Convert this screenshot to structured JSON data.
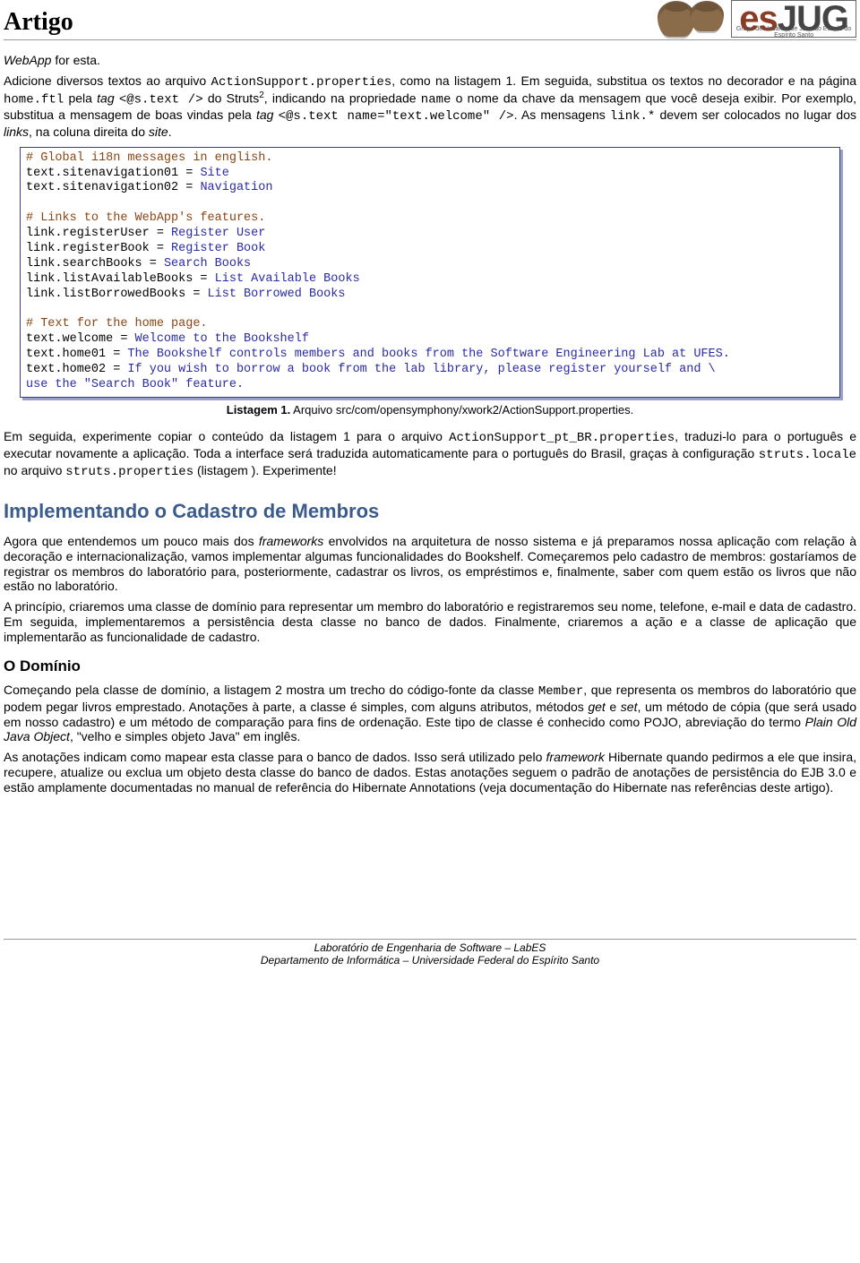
{
  "header": {
    "title": "Artigo",
    "logo_text": "esJUG",
    "logo_subtitle": "Grupo de Usuários de Java do Estado do Espírito Santo"
  },
  "intro": {
    "p1_part1": "WebApp",
    "p1_part2": " for esta.",
    "p2_part1": "Adicione diversos textos ao arquivo ",
    "p2_code1": "ActionSupport.properties",
    "p2_part2": ", como na listagem 1. Em seguida, substitua os textos no decorador e na página ",
    "p2_code2": "home.ftl",
    "p2_part3": " pela ",
    "p2_ital1": "tag",
    "p2_part4": " ",
    "p2_code3": "<@s.text />",
    "p2_part5": " do Struts",
    "p2_sup": "2",
    "p2_part6": ", indicando na propriedade ",
    "p2_code4": "name",
    "p2_part7": " o nome da chave da mensagem que você deseja exibir. Por exemplo, substitua a mensagem de boas vindas pela ",
    "p2_ital2": "tag",
    "p2_part8": " ",
    "p2_code5": "<@s.text name=\"text.welcome\" />",
    "p2_part9": ". As mensagens ",
    "p2_code6": "link.*",
    "p2_part10": " devem ser colocados no lugar dos ",
    "p2_ital3": "links",
    "p2_part11": ", na coluna direita do ",
    "p2_ital4": "site",
    "p2_part12": "."
  },
  "listing1": {
    "c1": "# Global i18n messages in english.",
    "l2a": "text.sitenavigation01 = ",
    "l2b": "Site",
    "l3a": "text.sitenavigation02 = ",
    "l3b": "Navigation",
    "c2": "# Links to the WebApp's features.",
    "l5a": "link.registerUser = ",
    "l5b": "Register User",
    "l6a": "link.registerBook = ",
    "l6b": "Register Book",
    "l7a": "link.searchBooks = ",
    "l7b": "Search Books",
    "l8a": "link.listAvailableBooks = ",
    "l8b": "List Available Books",
    "l9a": "link.listBorrowedBooks = ",
    "l9b": "List Borrowed Books",
    "c3": "# Text for the home page.",
    "l11a": "text.welcome = ",
    "l11b": "Welcome to the Bookshelf",
    "l12a": "text.home01 = ",
    "l12b": "The Bookshelf controls members and books from the Software Engineering Lab at UFES.",
    "l13a": "text.home02 = ",
    "l13b": "If you wish to borrow a book from the lab library, please register yourself and \\",
    "l14": "use the \"Search Book\" feature."
  },
  "caption1": {
    "bold": "Listagem 1.",
    "rest": " Arquivo src/com/opensymphony/xwork2/ActionSupport.properties."
  },
  "after": {
    "p1": "Em seguida, experimente copiar o conteúdo da listagem 1 para o arquivo ",
    "c1": "ActionSupport_pt_BR.properties",
    "p2": ", traduzi-lo para o português e executar novamente a aplicação. Toda a interface será traduzida automaticamente para o português do Brasil, graças à configuração ",
    "c2": "struts.locale",
    "p3": " no arquivo ",
    "c3": "struts.properties",
    "p4": " (listagem ). Experimente!"
  },
  "section1": {
    "title": "Implementando o Cadastro de Membros",
    "p1a": "Agora que entendemos um pouco mais dos ",
    "p1i": "frameworks",
    "p1b": " envolvidos na arquitetura de nosso sistema e já preparamos nossa aplicação com relação à decoração e internacionalização, vamos implementar algumas funcionalidades do Bookshelf. Começaremos pelo cadastro de membros: gostaríamos de registrar os membros do laboratório para, posteriormente, cadastrar os livros, os empréstimos e, finalmente, saber com quem estão os livros que não estão no laboratório.",
    "p2": "A princípio, criaremos uma classe de domínio para representar um membro do laboratório e registraremos seu nome, telefone, e-mail e data de cadastro. Em seguida, implementaremos a persistência desta classe no banco de dados. Finalmente, criaremos a ação e a classe de aplicação que implementarão as funcionalidade de cadastro."
  },
  "section2": {
    "title": "O Domínio",
    "p1a": "Começando pela classe de domínio, a listagem 2 mostra um trecho do código-fonte da classe ",
    "p1c": "Member",
    "p1b": ", que representa os membros do laboratório que podem pegar livros emprestado. Anotações à parte, a classe é simples, com alguns atributos, métodos ",
    "p1i1": "get",
    "p1d": " e ",
    "p1i2": "set",
    "p1e": ", um método de cópia (que será usado em nosso cadastro) e um método de comparação para fins de ordenação. Este tipo de classe é conhecido como POJO, abreviação do termo ",
    "p1i3": "Plain Old Java Object",
    "p1f": ", \"velho e simples objeto Java\" em inglês.",
    "p2a": "As anotações indicam como mapear esta classe para o banco de dados. Isso será utilizado pelo ",
    "p2i1": "framework",
    "p2b": " Hibernate quando pedirmos a ele que insira, recupere, atualize ou exclua um objeto desta classe do banco de dados. Estas anotações seguem o padrão de anotações de persistência do EJB 3.0 e estão amplamente documentadas no manual de referência do Hibernate Annotations (veja documentação do Hibernate nas referências deste artigo)."
  },
  "footer": {
    "l1": "Laboratório de Engenharia de Software – LabES",
    "l2": "Departamento de Informática – Universidade Federal do Espírito Santo"
  }
}
